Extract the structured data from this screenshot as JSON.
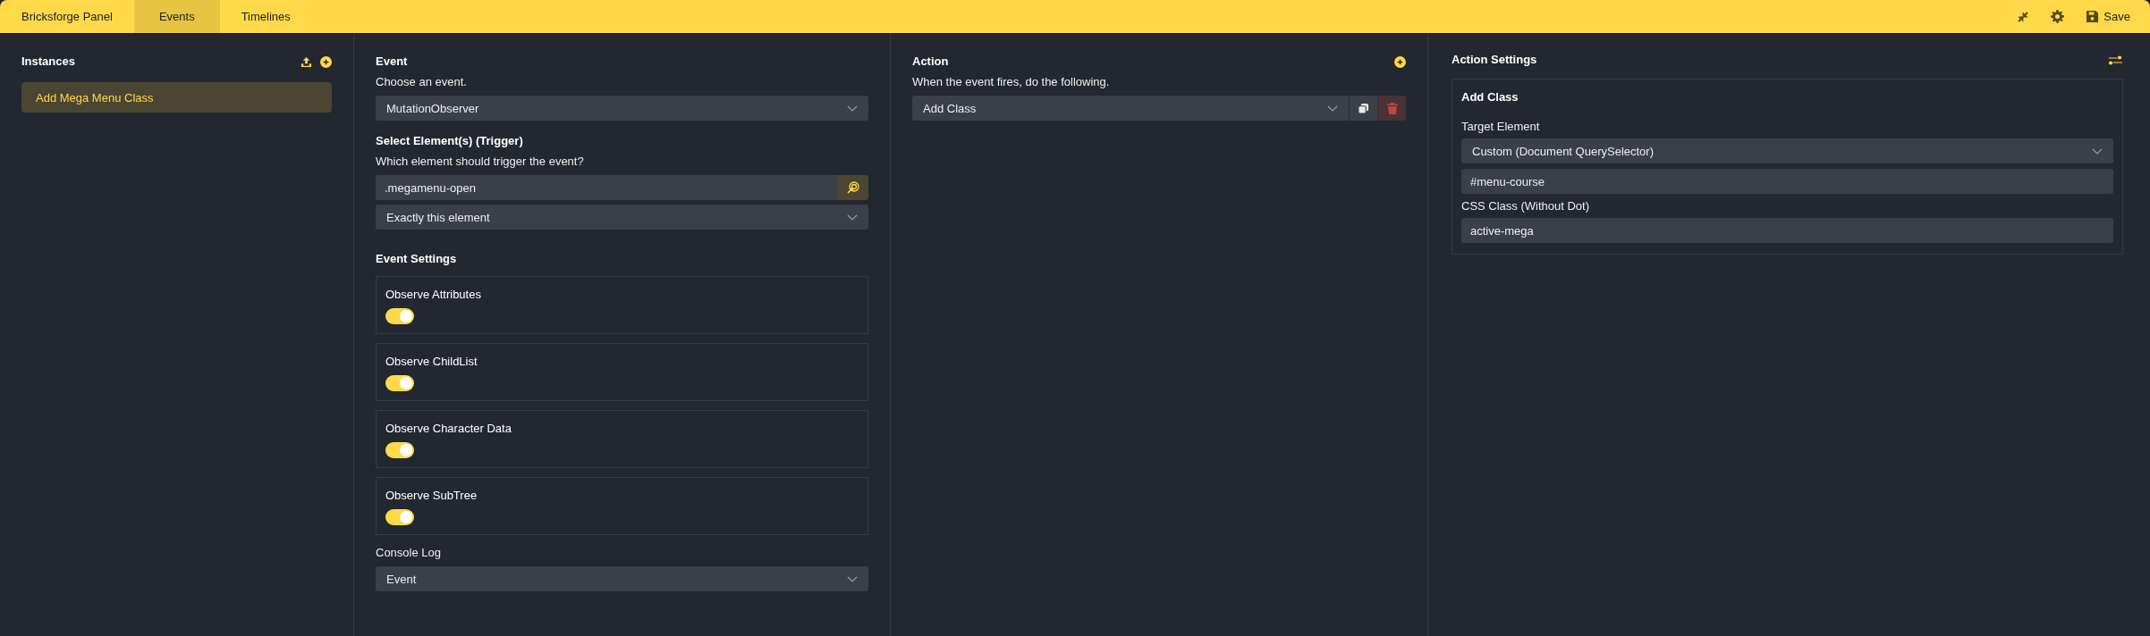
{
  "tabs": [
    {
      "label": "Bricksforge Panel",
      "selected": false
    },
    {
      "label": "Events",
      "selected": true
    },
    {
      "label": "Timelines",
      "selected": false
    }
  ],
  "toolbar": {
    "save_label": "Save"
  },
  "instances": {
    "title": "Instances",
    "items": [
      {
        "label": "Add Mega Menu Class",
        "selected": true
      }
    ]
  },
  "event": {
    "title": "Event",
    "hint": "Choose an event.",
    "event_select": "MutationObserver",
    "trigger_title": "Select Element(s) (Trigger)",
    "trigger_hint": "Which element should trigger the event?",
    "selector_value": ".megamenu-open",
    "scope_select": "Exactly this element",
    "settings_title": "Event Settings",
    "settings": [
      {
        "label": "Observe Attributes",
        "on": true
      },
      {
        "label": "Observe ChildList",
        "on": true
      },
      {
        "label": "Observe Character Data",
        "on": true
      },
      {
        "label": "Observe SubTree",
        "on": true
      }
    ],
    "console_label": "Console Log",
    "console_select": "Event"
  },
  "action": {
    "title": "Action",
    "hint": "When the event fires, do the following.",
    "actions": [
      {
        "value": "Add Class"
      }
    ]
  },
  "action_settings": {
    "title": "Action Settings",
    "card_title": "Add Class",
    "fields": [
      {
        "label": "Target Element",
        "kind": "select",
        "value": "Custom (Document QuerySelector)"
      },
      {
        "kind": "input",
        "value": "#menu-course"
      },
      {
        "label": "CSS Class (Without Dot)",
        "kind": "input",
        "value": "active-mega"
      }
    ]
  }
}
